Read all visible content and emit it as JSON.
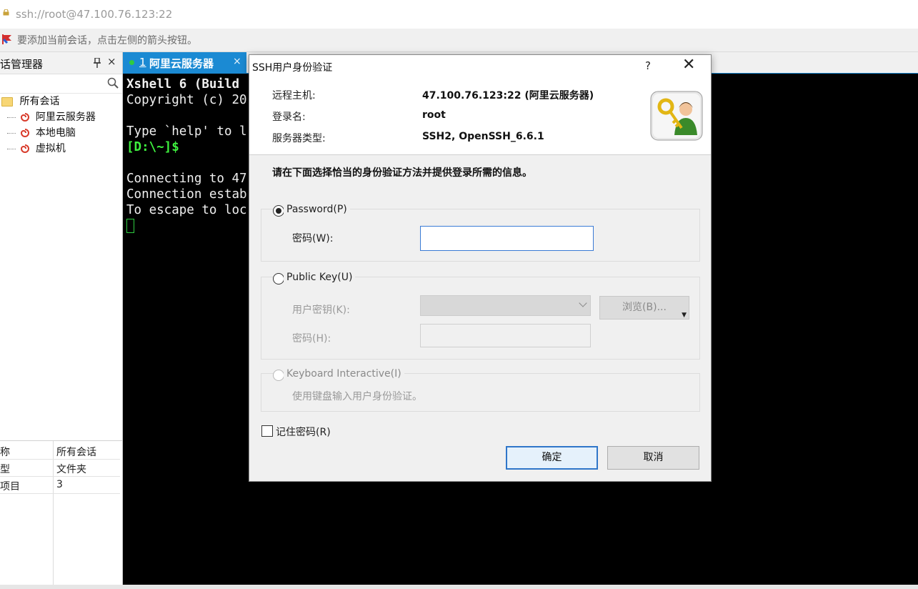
{
  "address_bar": {
    "url": "ssh://root@47.100.76.123:22"
  },
  "hint_bar": {
    "text": "要添加当前会话，点击左侧的箭头按钮。"
  },
  "session_manager": {
    "title": "话管理器",
    "pin_icon": "pin-icon",
    "close_label": "×",
    "tree": {
      "root": "所有会话",
      "items": [
        "阿里云服务器",
        "本地电脑",
        "虚拟机"
      ]
    },
    "properties": [
      {
        "key": "称",
        "value": "所有会话"
      },
      {
        "key": "型",
        "value": "文件夹"
      },
      {
        "key": "项目",
        "value": "3"
      }
    ]
  },
  "tabs": [
    {
      "number": "1",
      "label": "阿里云服务器",
      "close": "×",
      "active": true
    }
  ],
  "terminal": {
    "lines": [
      {
        "text": "Xshell 6 (Build",
        "style": "b"
      },
      {
        "text": "Copyright (c) 20",
        "style": ""
      },
      {
        "text": "",
        "style": ""
      },
      {
        "text": "Type `help' to l",
        "style": ""
      },
      {
        "text": "[D:\\~]$",
        "style": "g"
      },
      {
        "text": "",
        "style": ""
      },
      {
        "text": "Connecting to 47",
        "style": ""
      },
      {
        "text": "Connection estab",
        "style": ""
      },
      {
        "text": "To escape to loc",
        "style": ""
      }
    ]
  },
  "dialog": {
    "title": "SSH用户身份验证",
    "help_label": "?",
    "close_label": "✕",
    "info": {
      "remote_host_label": "远程主机:",
      "remote_host_value": "47.100.76.123:22 (阿里云服务器)",
      "login_label": "登录名:",
      "login_value": "root",
      "server_type_label": "服务器类型:",
      "server_type_value": "SSH2, OpenSSH_6.6.1"
    },
    "instruction": "请在下面选择恰当的身份验证方法并提供登录所需的信息。",
    "password_group": {
      "radio_label": "Password(P)",
      "field_label": "密码(W):",
      "value": "",
      "selected": true
    },
    "publickey_group": {
      "radio_label": "Public Key(U)",
      "user_key_label": "用户密钥(K):",
      "browse_label": "浏览(B)...",
      "passphrase_label": "密码(H):"
    },
    "keyboard_group": {
      "radio_label": "Keyboard Interactive(I)",
      "description": "使用键盘输入用户身份验证。"
    },
    "remember_label": "记住密码(R)",
    "remember_checked": false,
    "ok_label": "确定",
    "cancel_label": "取消"
  },
  "colors": {
    "accent": "#1b8ad3",
    "terminal_bg": "#000000",
    "prompt": "#3ef03e"
  }
}
